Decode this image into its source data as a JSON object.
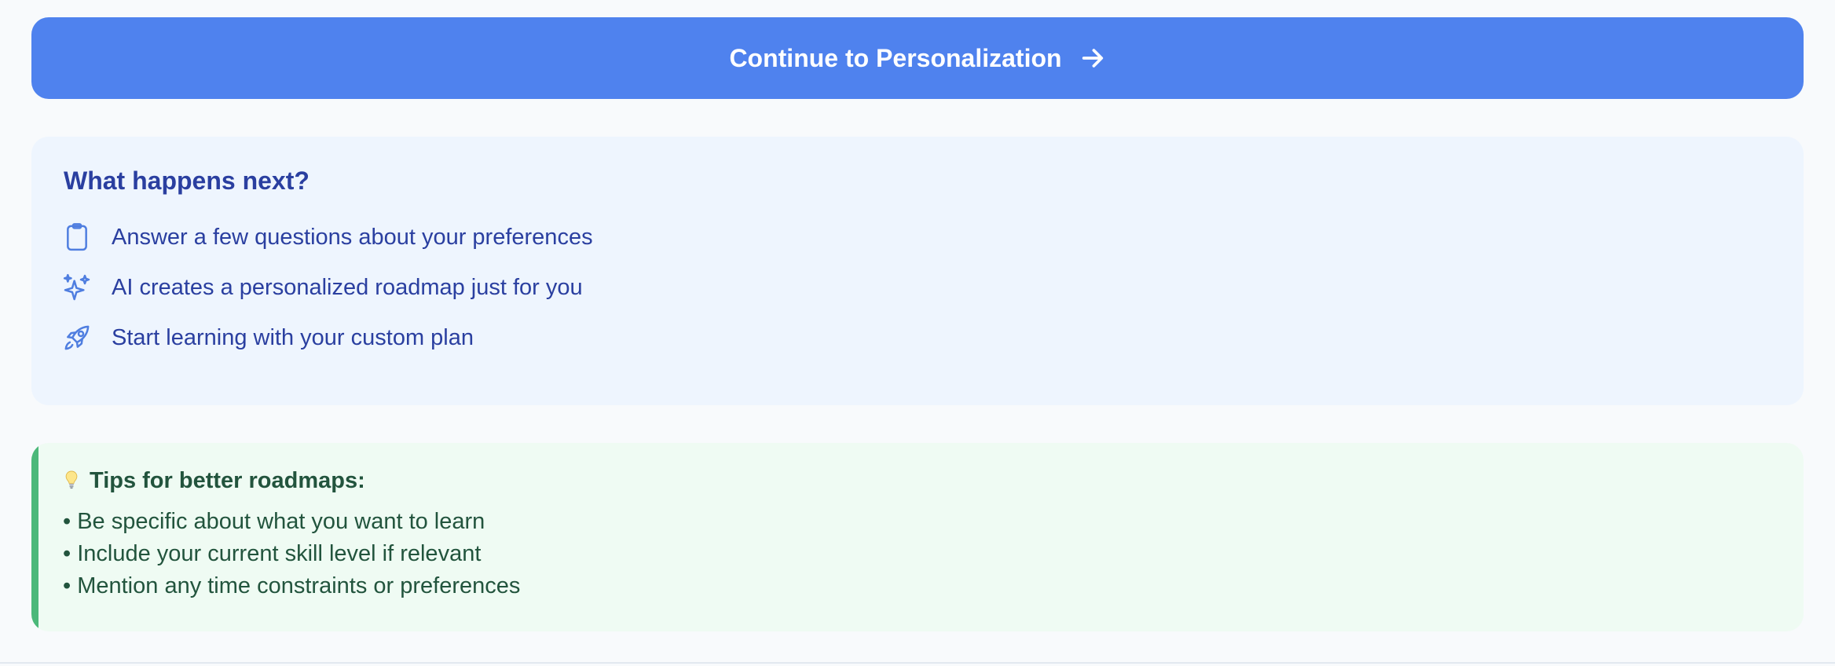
{
  "continue_button": {
    "label": "Continue to Personalization",
    "icon": "arrow-right-icon",
    "color": "#4f82ee"
  },
  "next_steps": {
    "title": "What happens next?",
    "items": [
      {
        "icon": "clipboard-icon",
        "text": "Answer a few questions about your preferences"
      },
      {
        "icon": "sparkles-icon",
        "text": "AI creates a personalized roadmap just for you"
      },
      {
        "icon": "rocket-icon",
        "text": "Start learning with your custom plan"
      }
    ]
  },
  "tips": {
    "icon": "lightbulb-icon",
    "title": "Tips for better roadmaps:",
    "items": [
      "• Be specific about what you want to learn",
      "• Include your current skill level if relevant",
      "• Mention any time constraints or preferences"
    ],
    "accent_color": "#4cb87a"
  }
}
